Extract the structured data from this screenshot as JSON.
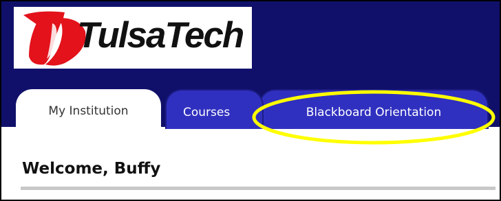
{
  "logo": {
    "text": "TulsaTech",
    "colors": {
      "mark": "#e3121b",
      "text": "#111111"
    }
  },
  "tabs": [
    {
      "label": "My Institution",
      "active": true
    },
    {
      "label": "Courses",
      "active": false
    },
    {
      "label": "Blackboard Orientation",
      "active": false
    }
  ],
  "welcome": {
    "text": "Welcome, Buffy"
  },
  "colors": {
    "banner": "#10106b",
    "tab_inactive": "#3030c0",
    "tab_active": "#ffffff",
    "highlight_ring": "#ffff00",
    "divider": "#c8c8c8"
  }
}
